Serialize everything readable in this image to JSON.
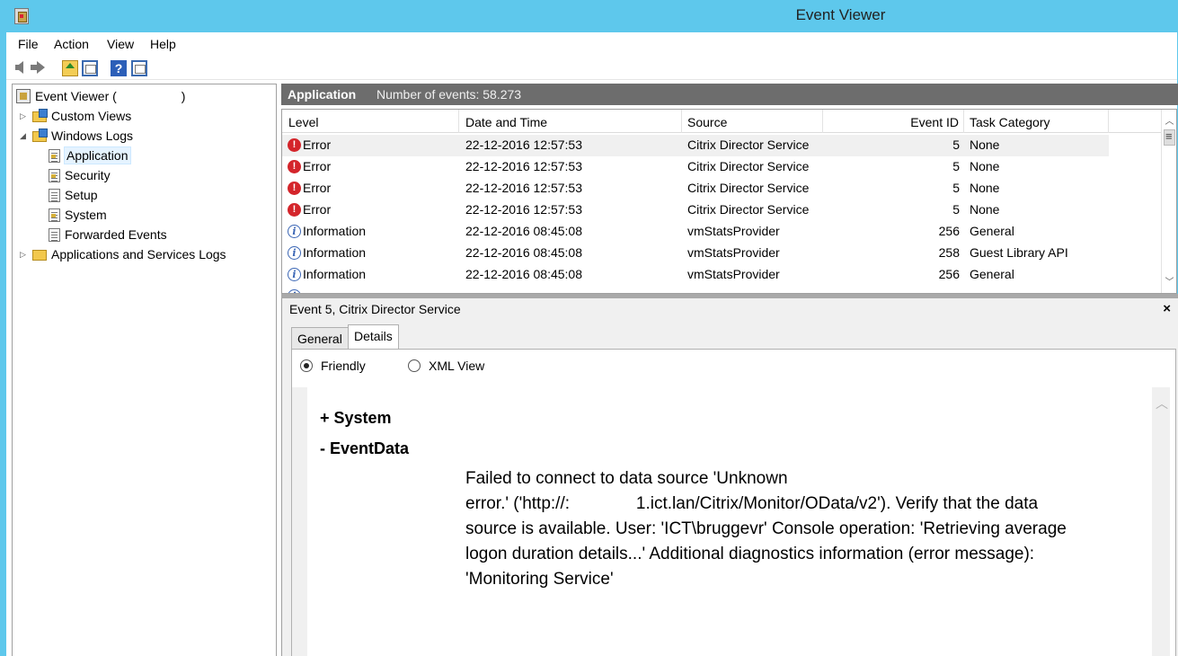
{
  "window": {
    "title": "Event Viewer"
  },
  "menu": [
    "File",
    "Action",
    "View",
    "Help"
  ],
  "tree": {
    "root": "Event Viewer (",
    "root_suffix": ")",
    "custom_views": "Custom Views",
    "windows_logs": "Windows Logs",
    "logs": [
      "Application",
      "Security",
      "Setup",
      "System",
      "Forwarded Events"
    ],
    "app_services": "Applications and Services Logs"
  },
  "header": {
    "log_name": "Application",
    "count_label": "Number of events: 58.273"
  },
  "columns": [
    "Level",
    "Date and Time",
    "Source",
    "Event ID",
    "Task Category"
  ],
  "events": [
    {
      "level": "Error",
      "datetime": "22-12-2016 12:57:53",
      "source": "Citrix Director Service",
      "event_id": "5",
      "category": "None"
    },
    {
      "level": "Error",
      "datetime": "22-12-2016 12:57:53",
      "source": "Citrix Director Service",
      "event_id": "5",
      "category": "None"
    },
    {
      "level": "Error",
      "datetime": "22-12-2016 12:57:53",
      "source": "Citrix Director Service",
      "event_id": "5",
      "category": "None"
    },
    {
      "level": "Error",
      "datetime": "22-12-2016 12:57:53",
      "source": "Citrix Director Service",
      "event_id": "5",
      "category": "None"
    },
    {
      "level": "Information",
      "datetime": "22-12-2016 08:45:08",
      "source": "vmStatsProvider",
      "event_id": "256",
      "category": "General"
    },
    {
      "level": "Information",
      "datetime": "22-12-2016 08:45:08",
      "source": "vmStatsProvider",
      "event_id": "258",
      "category": "Guest Library API"
    },
    {
      "level": "Information",
      "datetime": "22-12-2016 08:45:08",
      "source": "vmStatsProvider",
      "event_id": "256",
      "category": "General"
    }
  ],
  "detail": {
    "title": "Event 5, Citrix Director Service",
    "close": "×",
    "tabs": [
      "General",
      "Details"
    ],
    "view_friendly": "Friendly",
    "view_xml": "XML View",
    "system_label": "+ System",
    "eventdata_label": "-  EventData",
    "message_lines": [
      "Failed to connect to data source 'Unknown",
      "error.' ('http://:              1.ict.lan/Citrix/Monitor/OData/v2'). Verify that the data",
      "source is available. User: 'ICT\\bruggevr' Console operation: 'Retrieving average",
      "logon duration details...' Additional diagnostics information (error message):",
      "'Monitoring Service'"
    ]
  }
}
